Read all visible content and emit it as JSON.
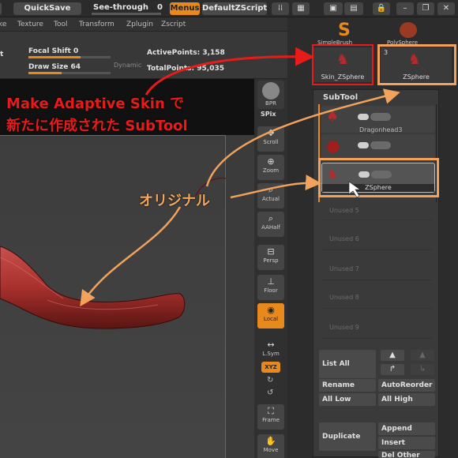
{
  "topbar": {
    "quicksave": "QuickSave",
    "see_through_label": "See-through",
    "see_through_value": "0",
    "menus": "Menus",
    "default_zscript": "DefaultZScript"
  },
  "menubar": [
    "ke",
    "Texture",
    "Tool",
    "Transform",
    "Zplugin",
    "Zscript"
  ],
  "draw": {
    "focal_shift_label": "Focal Shift",
    "focal_shift_value": "0",
    "draw_size_label": "Draw Size",
    "draw_size_value": "64",
    "dynamic": "Dynamic",
    "active_points": "ActivePoints: 3,158",
    "total_points": "TotalPoints: 95,035",
    "left_marker": "t"
  },
  "tool_strip": {
    "bpr": "BPR",
    "spix": "SPix",
    "scroll": "Scroll",
    "zoom": "Zoom",
    "actual": "Actual",
    "aahalf": "AAHalf",
    "persp": "Persp",
    "floor": "Floor",
    "local": "Local",
    "lsym": "L.Sym",
    "xyz": "XYZ",
    "frame": "Frame",
    "move": "Move"
  },
  "tool_palette": {
    "simple_brush": "SimpleBrush",
    "polysphere": "PolySphere",
    "skin_zsphere": "Skin_ZSphere",
    "zsphere": "ZSphere",
    "zsphere_count": "3"
  },
  "subtool": {
    "title": "SubTool",
    "items": [
      {
        "name": "",
        "selected": false
      },
      {
        "name": "Dragonhead3",
        "selected": false
      },
      {
        "name": "ZSphere",
        "selected": true
      }
    ],
    "unused": [
      "Unused 5",
      "Unused 6",
      "Unused 7",
      "Unused 8",
      "Unused 9",
      "Unused 10"
    ]
  },
  "subtool_buttons": {
    "list_all": "List All",
    "rename": "Rename",
    "auto_reorder": "AutoReorder",
    "all_low": "All Low",
    "all_high": "All High",
    "duplicate": "Duplicate",
    "append": "Append",
    "insert": "Insert",
    "del_other": "Del Other"
  },
  "annotations": {
    "red_line1": "Make Adaptive Skin で",
    "red_line2": "新たに作成された SubTool",
    "orange": "オリジナル"
  },
  "colors": {
    "accent": "#e8891d",
    "annotation_red": "#e81b1b",
    "annotation_orange": "#f2a25a",
    "model_red": "#b52b2b"
  }
}
